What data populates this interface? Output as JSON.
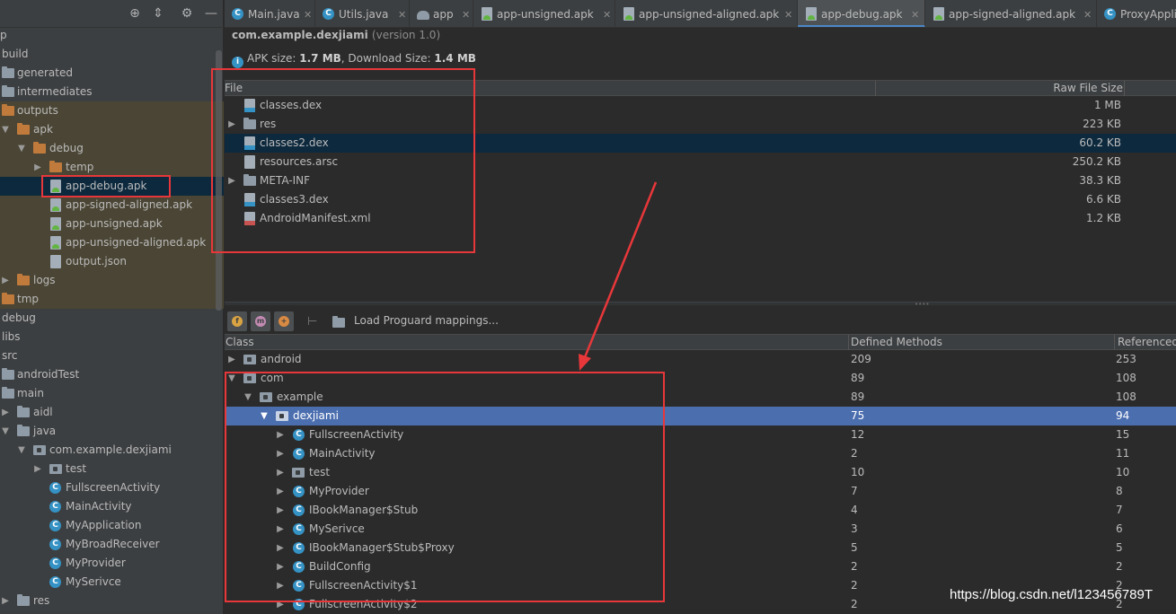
{
  "project_tree": {
    "rows": [
      {
        "label": "p"
      },
      {
        "label": "build"
      },
      {
        "label": "generated"
      },
      {
        "label": "intermediates"
      },
      {
        "label": "outputs"
      },
      {
        "label": "apk"
      },
      {
        "label": "debug"
      },
      {
        "label": "temp"
      },
      {
        "label": "app-debug.apk"
      },
      {
        "label": "app-signed-aligned.apk"
      },
      {
        "label": "app-unsigned.apk"
      },
      {
        "label": "app-unsigned-aligned.apk"
      },
      {
        "label": "output.json"
      },
      {
        "label": "logs"
      },
      {
        "label": "tmp"
      },
      {
        "label": "debug"
      },
      {
        "label": "libs"
      },
      {
        "label": "src"
      },
      {
        "label": "androidTest"
      },
      {
        "label": "main"
      },
      {
        "label": "aidl"
      },
      {
        "label": "java"
      },
      {
        "label": "com.example.dexjiami"
      },
      {
        "label": "test"
      },
      {
        "label": "FullscreenActivity"
      },
      {
        "label": "MainActivity"
      },
      {
        "label": "MyApplication"
      },
      {
        "label": "MyBroadReceiver"
      },
      {
        "label": "MyProvider"
      },
      {
        "label": "MySerivce"
      },
      {
        "label": "res"
      }
    ]
  },
  "tabs": [
    {
      "label": "Main.java"
    },
    {
      "label": "Utils.java"
    },
    {
      "label": "app"
    },
    {
      "label": "app-unsigned.apk"
    },
    {
      "label": "app-unsigned-aligned.apk"
    },
    {
      "label": "app-debug.apk"
    },
    {
      "label": "app-signed-aligned.apk"
    },
    {
      "label": "ProxyAppli"
    }
  ],
  "apk": {
    "package": "com.example.dexjiami",
    "version": "(version 1.0)",
    "size_prefix": "APK size: ",
    "apk_size": "1.7 MB",
    "download_prefix": ", Download Size: ",
    "download_size": "1.4 MB"
  },
  "file_table": {
    "col_file": "File",
    "col_size": "Raw File Size",
    "rows": [
      {
        "name": "classes.dex",
        "size": "1 MB"
      },
      {
        "name": "res",
        "size": "223 KB"
      },
      {
        "name": "classes2.dex",
        "size": "60.2 KB"
      },
      {
        "name": "resources.arsc",
        "size": "250.2 KB"
      },
      {
        "name": "META-INF",
        "size": "38.3 KB"
      },
      {
        "name": "classes3.dex",
        "size": "6.6 KB"
      },
      {
        "name": "AndroidManifest.xml",
        "size": "1.2 KB"
      }
    ]
  },
  "dex_toolbar": {
    "load_proguard": "Load Proguard mappings..."
  },
  "class_table": {
    "col_class": "Class",
    "col_defined": "Defined Methods",
    "col_referenced": "Referenced",
    "rows": [
      {
        "name": "android",
        "defined": "209",
        "referenced": "253"
      },
      {
        "name": "com",
        "defined": "89",
        "referenced": "108"
      },
      {
        "name": "example",
        "defined": "89",
        "referenced": "108"
      },
      {
        "name": "dexjiami",
        "defined": "75",
        "referenced": "94"
      },
      {
        "name": "FullscreenActivity",
        "defined": "12",
        "referenced": "15"
      },
      {
        "name": "MainActivity",
        "defined": "2",
        "referenced": "11"
      },
      {
        "name": "test",
        "defined": "10",
        "referenced": "10"
      },
      {
        "name": "MyProvider",
        "defined": "7",
        "referenced": "8"
      },
      {
        "name": "IBookManager$Stub",
        "defined": "4",
        "referenced": "7"
      },
      {
        "name": "MySerivce",
        "defined": "3",
        "referenced": "6"
      },
      {
        "name": "IBookManager$Stub$Proxy",
        "defined": "5",
        "referenced": "5"
      },
      {
        "name": "BuildConfig",
        "defined": "2",
        "referenced": "2"
      },
      {
        "name": "FullscreenActivity$1",
        "defined": "2",
        "referenced": "2"
      },
      {
        "name": "FullscreenActivity$2",
        "defined": "2",
        "referenced": "2"
      }
    ]
  },
  "watermark": "https://blog.csdn.net/l123456789T",
  "colors": {
    "background": "#2b2b2b",
    "panel": "#3c3f41",
    "selection": "#0d293e",
    "row_highlight": "#4b6eaf",
    "annotation_red": "#e8373a",
    "class_icon": "#3592c4",
    "folder_orange": "#c07a3c"
  }
}
